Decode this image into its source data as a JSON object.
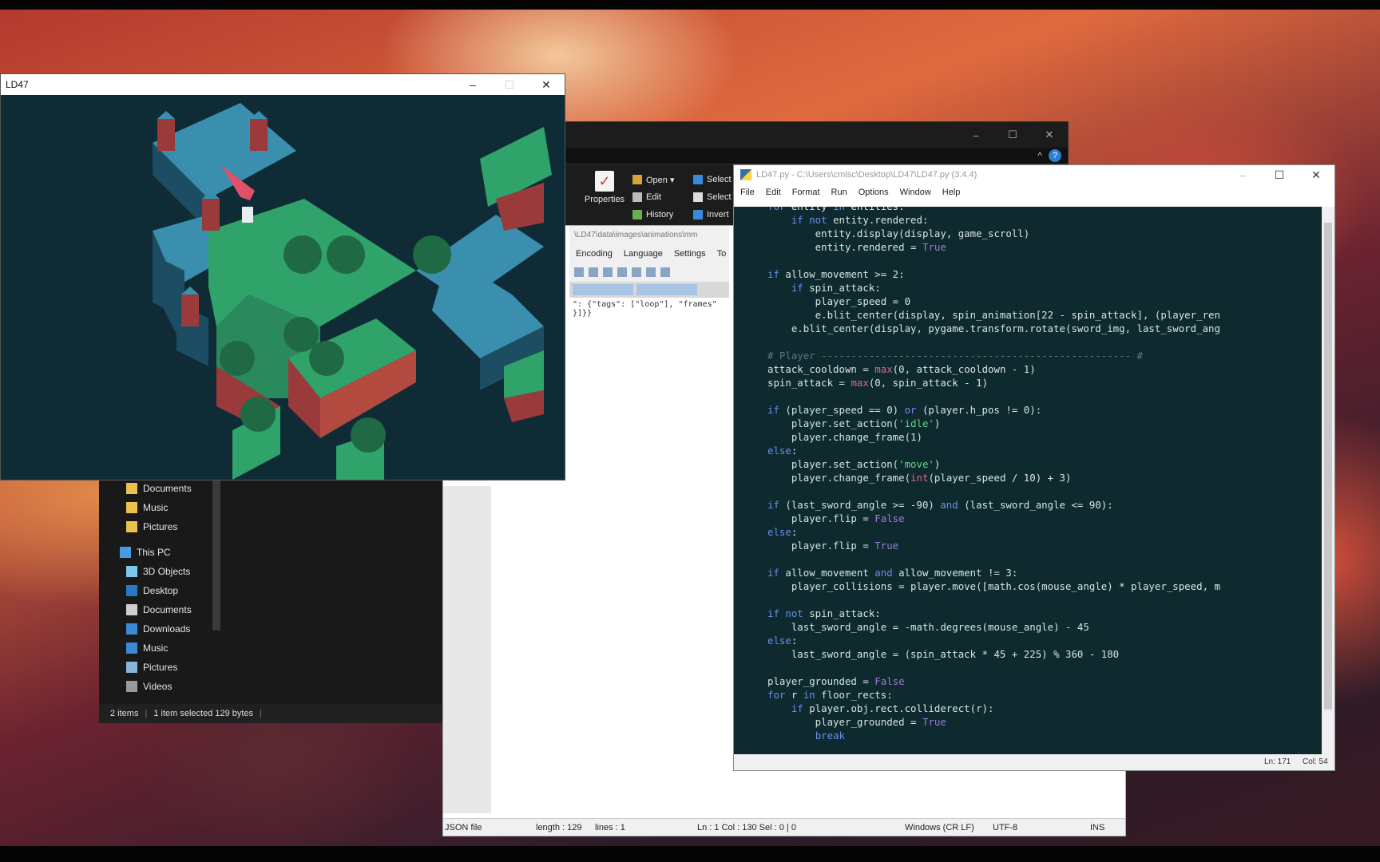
{
  "game_window": {
    "title": "LD47",
    "min": "–",
    "max": "☐",
    "close": "✕"
  },
  "explorer": {
    "ribbon": {
      "properties": "Properties",
      "open": "Open ▾",
      "edit": "Edit",
      "history": "History",
      "select_all": "Select",
      "select_none": "Select",
      "invert": "Invert"
    },
    "nav_items": [
      {
        "label": "Documents",
        "icon": "folder-icon"
      },
      {
        "label": "Music",
        "icon": "folder-icon"
      },
      {
        "label": "Pictures",
        "icon": "folder-icon"
      },
      {
        "label": "This PC",
        "icon": "computer-icon"
      },
      {
        "label": "3D Objects",
        "icon": "cube-icon"
      },
      {
        "label": "Desktop",
        "icon": "desktop-icon"
      },
      {
        "label": "Documents",
        "icon": "document-icon"
      },
      {
        "label": "Downloads",
        "icon": "download-icon"
      },
      {
        "label": "Music",
        "icon": "music-icon"
      },
      {
        "label": "Pictures",
        "icon": "picture-icon"
      },
      {
        "label": "Videos",
        "icon": "video-icon"
      }
    ],
    "status": {
      "items": "2 items",
      "selected": "1 item selected  129 bytes"
    }
  },
  "notepadpp": {
    "path": "\\LD47\\data\\images\\animations\\mm",
    "menu": [
      "Encoding",
      "Language",
      "Settings",
      "To"
    ],
    "code_line1": "\": {\"tags\": [\"loop\"], \"frames\"",
    "code_line2": "}]}}",
    "status": {
      "type": "JSON file",
      "length": "length : 129",
      "lines": "lines : 1",
      "pos": "Ln : 1    Col : 130    Sel : 0 | 0",
      "eol": "Windows (CR LF)",
      "enc": "UTF-8",
      "mode": "INS"
    }
  },
  "idle": {
    "title": "LD47.py - C:\\Users\\cmlsc\\Desktop\\LD47\\LD47.py (3.4.4)",
    "menu": [
      "File",
      "Edit",
      "Format",
      "Run",
      "Options",
      "Window",
      "Help"
    ],
    "status": {
      "ln": "Ln: 171",
      "col": "Col: 54"
    }
  }
}
